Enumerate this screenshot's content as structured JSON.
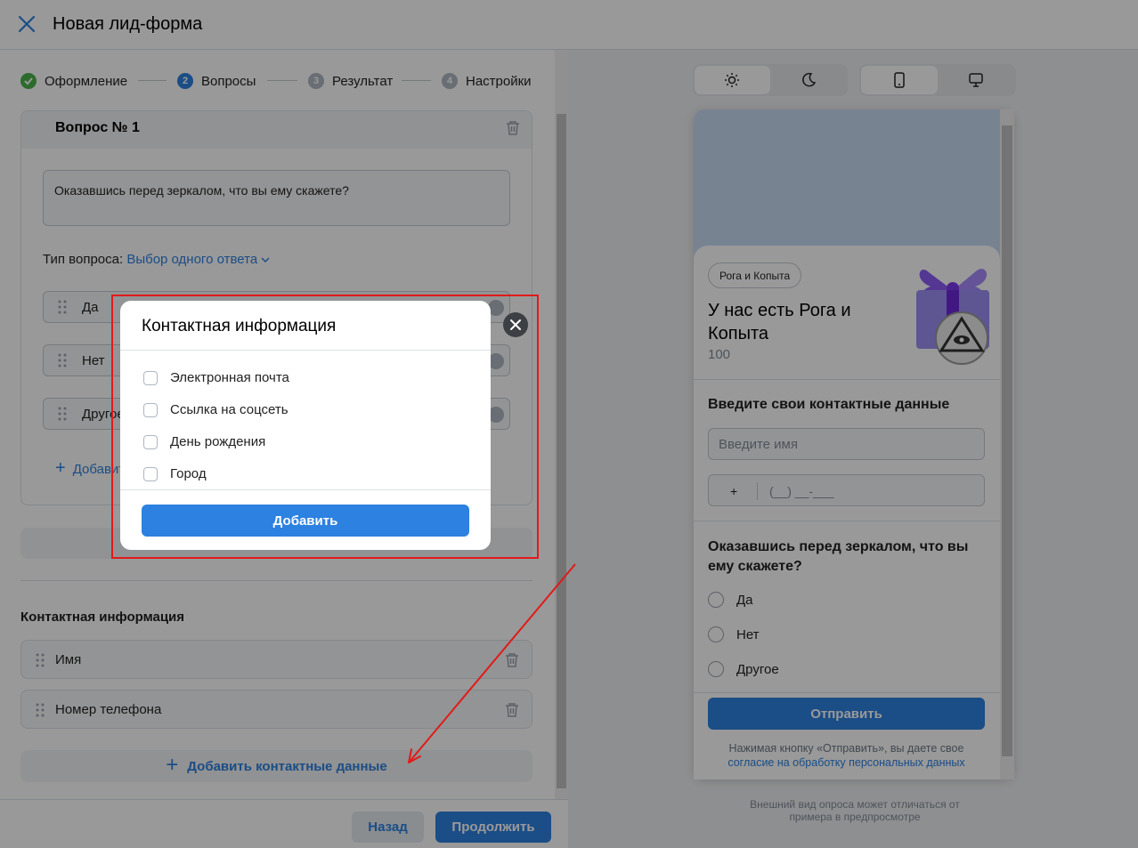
{
  "header": {
    "title": "Новая лид-форма"
  },
  "stepper": [
    {
      "label": "Оформление",
      "state": "done"
    },
    {
      "num": "2",
      "label": "Вопросы",
      "state": "active"
    },
    {
      "num": "3",
      "label": "Результат",
      "state": "pending"
    },
    {
      "num": "4",
      "label": "Настройки",
      "state": "pending"
    }
  ],
  "question": {
    "title": "Вопрос № 1",
    "text": "Оказавшись перед зеркалом, что вы ему скажете?",
    "type_label": "Тип вопроса:",
    "type_value": "Выбор одного ответа",
    "options": [
      "Да",
      "Нет",
      "Другое"
    ],
    "add_option": "Добавить вариант"
  },
  "contacts": {
    "title": "Контактная информация",
    "items": [
      "Имя",
      "Номер телефона"
    ],
    "add_label": "Добавить контактные данные"
  },
  "footer": {
    "back": "Назад",
    "next": "Продолжить"
  },
  "preview": {
    "brand": "Рога и Копыта",
    "headline": "У нас есть Рога и Копыта",
    "count": "100",
    "contacts_heading": "Введите свои контактные данные",
    "name_placeholder": "Введите имя",
    "phone_prefix": "+",
    "phone_mask": "(__) __-___",
    "question": "Оказавшись перед зеркалом, что вы ему скажете?",
    "options": [
      "Да",
      "Нет",
      "Другое"
    ],
    "submit": "Отправить",
    "consent_text": "Нажимая кнопку «Отправить», вы даете свое",
    "consent_link": "согласие на обработку персональных данных",
    "note": "Внешний вид опроса может отличаться от примера в предпросмотре"
  },
  "modal": {
    "title": "Контактная информация",
    "options": [
      "Электронная почта",
      "Ссылка на соцсеть",
      "День рождения",
      "Город"
    ],
    "add_button": "Добавить"
  },
  "colors": {
    "accent": "#2d81e0",
    "annotation": "#e11a1a",
    "success": "#4bb34b"
  }
}
